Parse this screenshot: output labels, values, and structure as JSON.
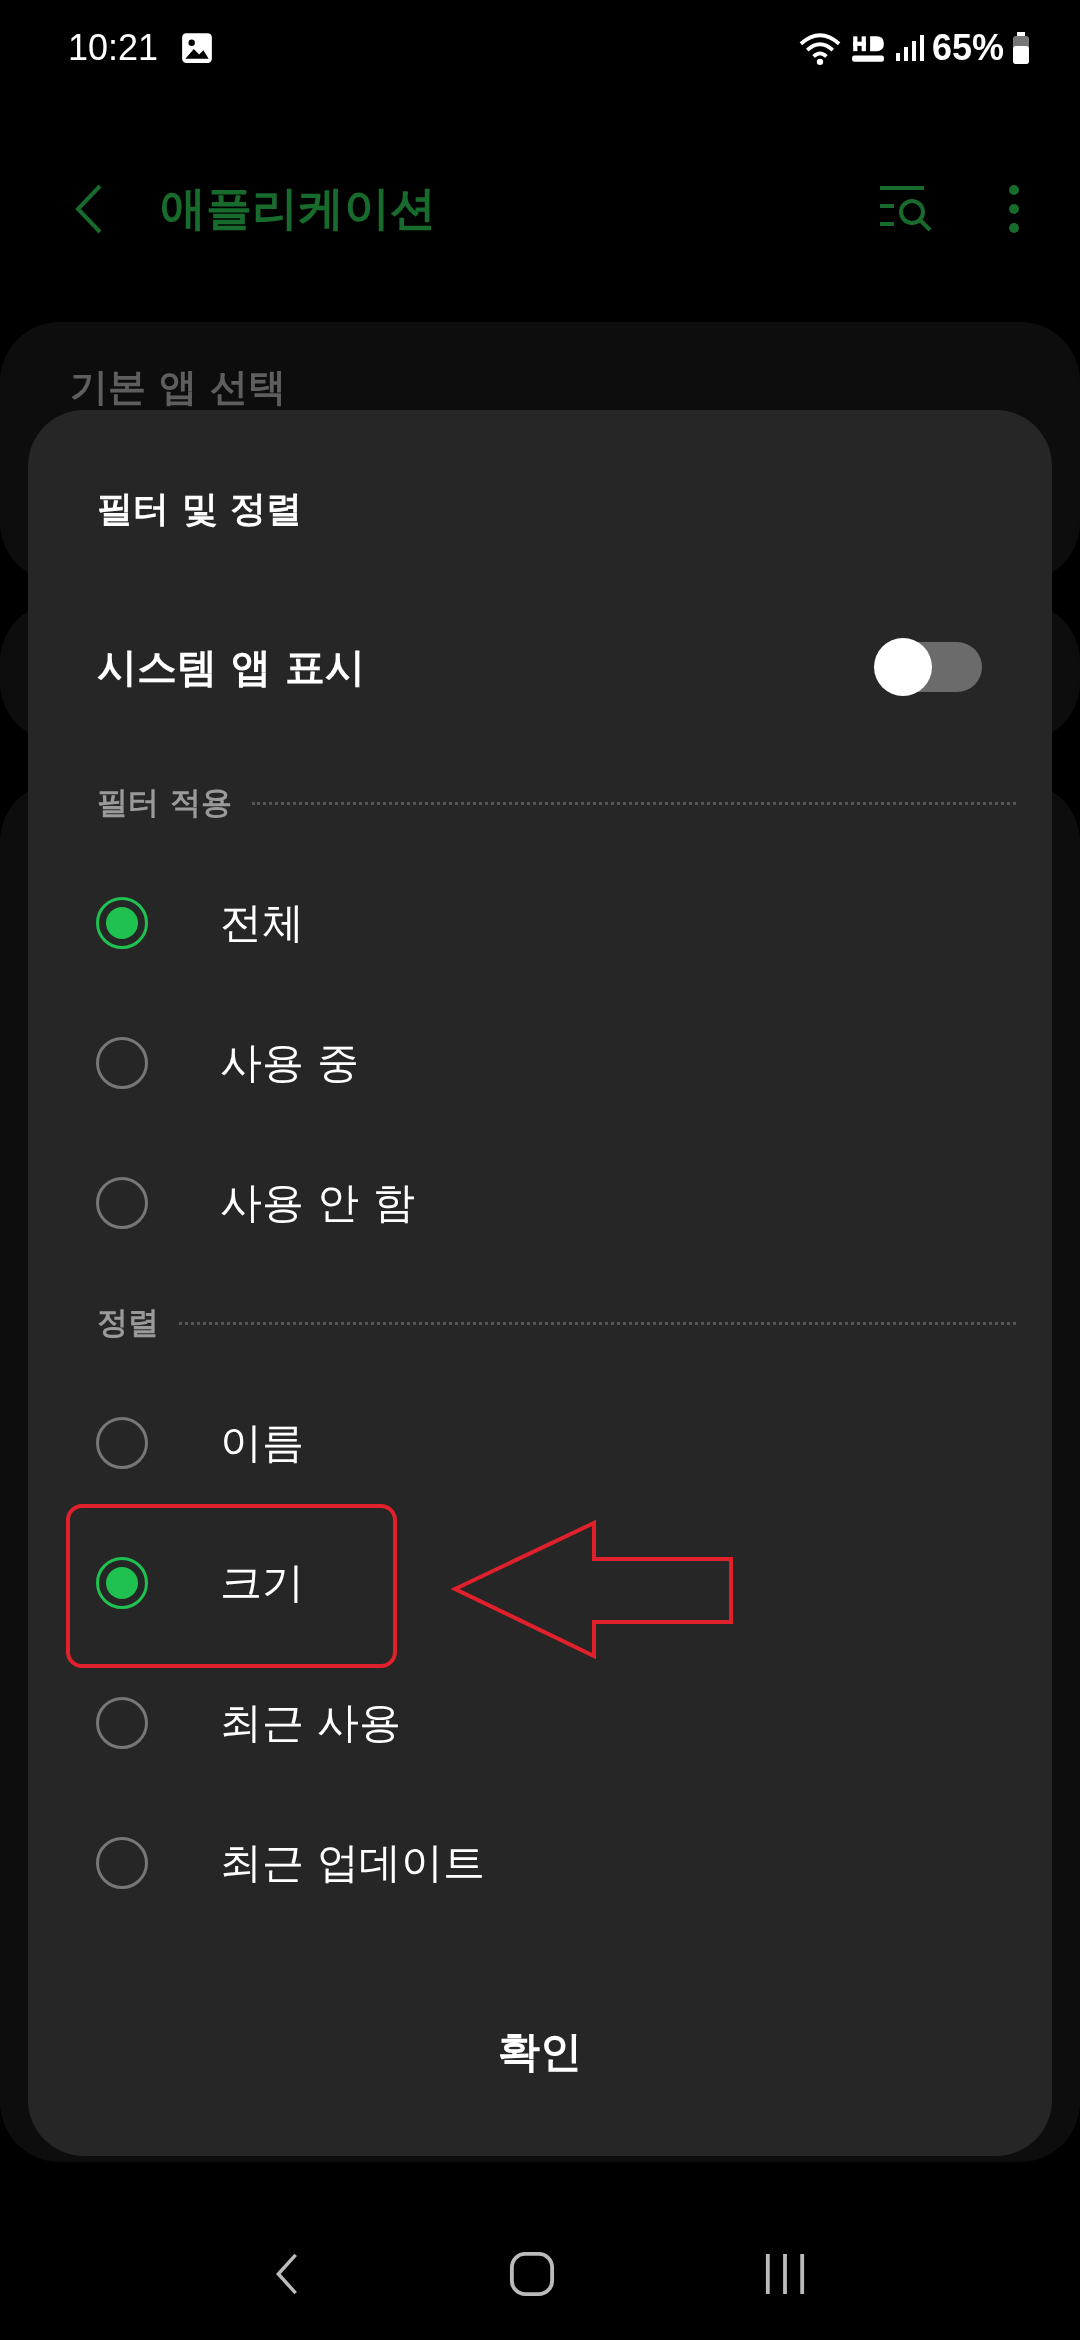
{
  "status_bar": {
    "time": "10:21",
    "battery": "65%"
  },
  "header": {
    "title": "애플리케이션"
  },
  "background": {
    "card_title": "기본 앱 선택"
  },
  "sheet": {
    "title": "필터 및 정렬",
    "toggle": {
      "label": "시스템 앱 표시",
      "on": false
    },
    "sections": [
      {
        "label": "필터 적용",
        "options": [
          {
            "label": "전체",
            "selected": true
          },
          {
            "label": "사용 중",
            "selected": false
          },
          {
            "label": "사용 안 함",
            "selected": false
          }
        ]
      },
      {
        "label": "정렬",
        "options": [
          {
            "label": "이름",
            "selected": false
          },
          {
            "label": "크기",
            "selected": true
          },
          {
            "label": "최근 사용",
            "selected": false
          },
          {
            "label": "최근 업데이트",
            "selected": false
          }
        ]
      }
    ],
    "confirm": "확인"
  }
}
